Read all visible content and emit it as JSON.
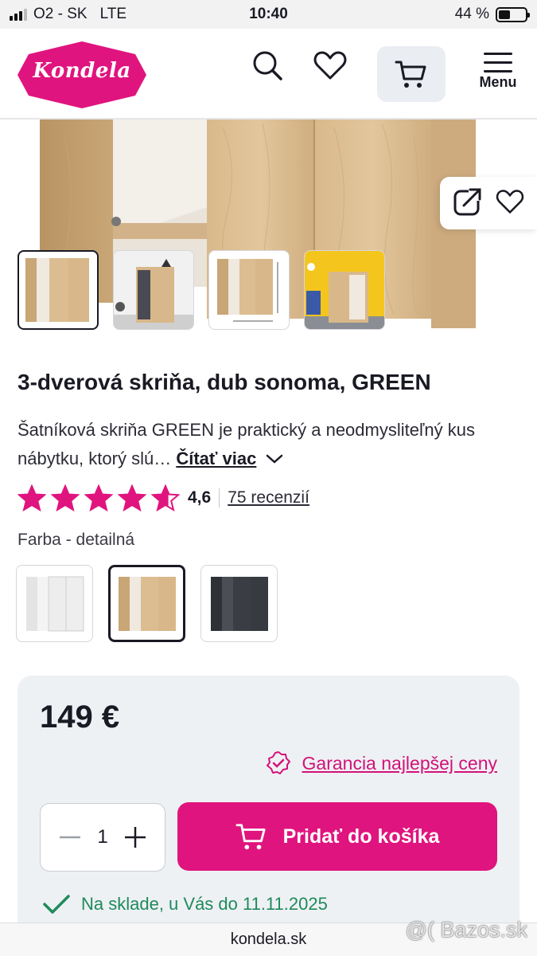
{
  "status_bar": {
    "carrier": "O2 - SK",
    "network": "LTE",
    "time": "10:40",
    "battery": "44 %",
    "battery_level": 0.44
  },
  "header": {
    "logo_text": "Kondela",
    "menu_label": "Menu",
    "icons": [
      "search-icon",
      "heart-icon",
      "cart-icon",
      "menu-icon"
    ]
  },
  "gallery": {
    "thumbnail_count": 4,
    "active_thumbnail": 0,
    "actions": [
      "share-icon",
      "heart-icon"
    ]
  },
  "product": {
    "title": "3-dverová skriňa, dub sonoma, GREEN",
    "description": "Šatníková skriňa GREEN je praktický a neodmysliteľný kus nábytku, ktorý slú…",
    "read_more": "Čítať viac",
    "rating_value": "4,6",
    "rating_stars": 4.6,
    "reviews": "75 recenzií",
    "color_label": "Farba - detailná",
    "swatches": [
      "white",
      "oak-sonoma",
      "anthracite"
    ],
    "active_swatch": 1
  },
  "purchase": {
    "price": "149 €",
    "guarantee": "Garancia najlepšej ceny",
    "quantity": "1",
    "add_to_cart": "Pridať do košíka",
    "stock": "Na sklade, u Vás do 11.11.2025"
  },
  "browser": {
    "url": "kondela.sk"
  },
  "watermark": "@( Bazos.sk",
  "colors": {
    "brand": "#e0147e",
    "stock_green": "#1f8a5b",
    "card_bg": "#eef1f4"
  }
}
